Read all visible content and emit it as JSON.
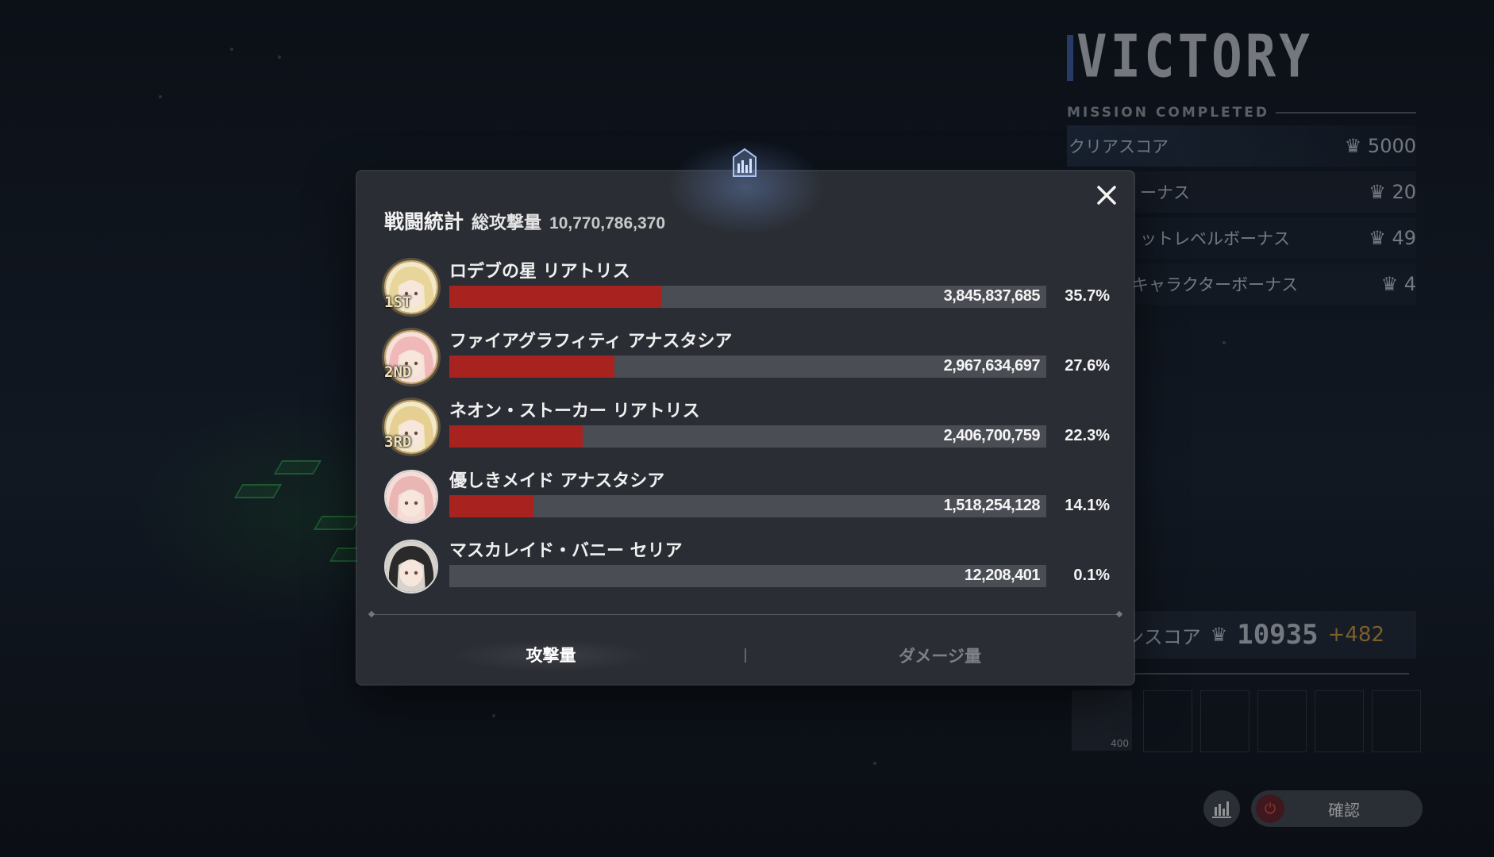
{
  "background_panel": {
    "victory_title": "VICTORY",
    "mission_label": "MISSION COMPLETED",
    "score_rows": [
      {
        "label": "クリアスコア",
        "value": "5000"
      },
      {
        "label": "ーナス",
        "value": "20"
      },
      {
        "label": "ットレベルボーナス",
        "value": "49"
      },
      {
        "label": "キャラクターボーナス",
        "value": "4"
      }
    ],
    "season_label": "ーズンスコア",
    "season_score": "10935",
    "season_delta": "+482",
    "reward_count": "400",
    "confirm_label": "確認"
  },
  "modal": {
    "title": "戦闘統計",
    "total_label": "総攻撃量",
    "total_value": "10,770,786,370",
    "close_icon": "close-icon",
    "header_icon": "bar-chart-icon",
    "tabs": [
      {
        "label": "攻撃量",
        "active": true
      },
      {
        "label": "ダメージ量",
        "active": false
      }
    ]
  },
  "chart_data": {
    "type": "bar",
    "title": "戦闘統計",
    "categories": [
      "ロデブの星 リアトリス",
      "ファイアグラフィティ アナスタシア",
      "ネオン・ストーカー リアトリス",
      "優しきメイド アナスタシア",
      "マスカレイド・バニー セリア"
    ],
    "series": [
      {
        "values": [
          3845837685,
          2967634697,
          2406700759,
          1518254128,
          12208401
        ]
      }
    ],
    "value_labels": [
      "3,845,837,685",
      "2,967,634,697",
      "2,406,700,759",
      "1,518,254,128",
      "12,208,401"
    ],
    "percent_labels": [
      "35.7%",
      "27.6%",
      "22.3%",
      "14.1%",
      "0.1%"
    ],
    "percents": [
      35.7,
      27.6,
      22.3,
      14.1,
      0.1
    ],
    "ranks": [
      "1ST",
      "2ND",
      "3RD",
      "",
      ""
    ],
    "bar_color": "#a8221f",
    "track_color": "#4a4d54"
  },
  "avatars": [
    {
      "hair": "#e8d59a",
      "accent": "#f3e9c9"
    },
    {
      "hair": "#f0b8b8",
      "accent": "#f7e0d8"
    },
    {
      "hair": "#e6cf92",
      "accent": "#f3e9c9"
    },
    {
      "hair": "#e9b6b4",
      "accent": "#f6dcd6"
    },
    {
      "hair": "#2a2a2a",
      "accent": "#d8d2cc"
    }
  ]
}
